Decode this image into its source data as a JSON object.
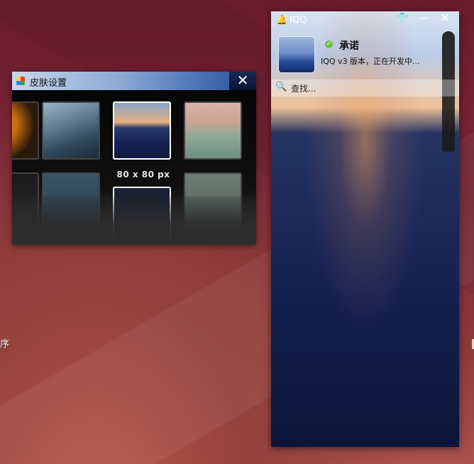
{
  "desktop": {
    "label": "序"
  },
  "skin_window": {
    "title": "皮肤设置",
    "close_label": "✕",
    "size_label": "80 x 80 px",
    "thumbnails": [
      "thumb-sunset-orange",
      "thumb-beach-waves",
      "thumb-blue-beach-selected",
      "thumb-pink-sea",
      "thumb-dark-partial",
      "thumb-teal-water",
      "thumb-dark-selected",
      "thumb-grey-sand"
    ]
  },
  "iqq_window": {
    "title": "IQQ",
    "logo_icon": "🔔",
    "skin_icon": "👕",
    "min_label": "—",
    "close_label": "✕",
    "status_icon": "✓",
    "nickname": "承诺",
    "signature": "IQQ v3 版本，正在开发中...",
    "search_icon": "🔍",
    "search_placeholder": "查找..."
  }
}
